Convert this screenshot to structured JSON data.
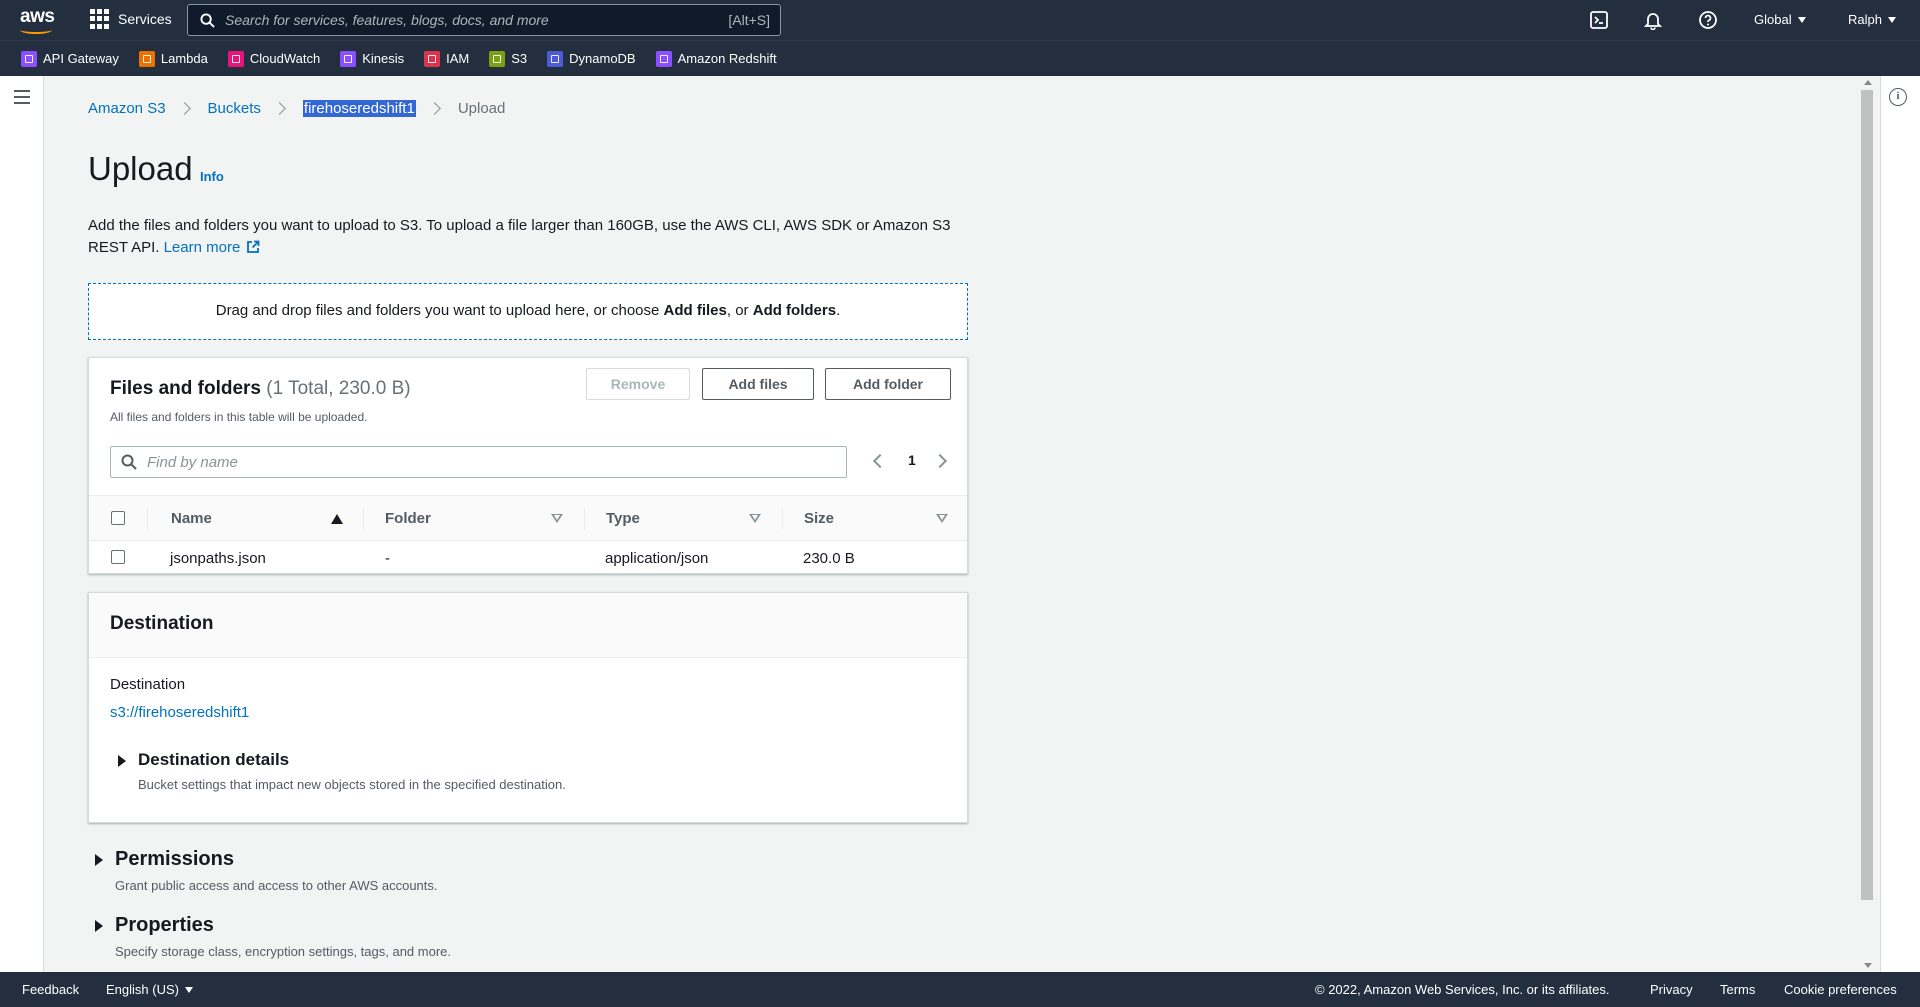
{
  "topnav": {
    "logo_text": "aws",
    "services_label": "Services",
    "search_placeholder": "Search for services, features, blogs, docs, and more",
    "search_shortcut": "[Alt+S]",
    "region_label": "Global",
    "user_label": "Ralph"
  },
  "favorites": [
    {
      "label": "API Gateway",
      "color": "#8c4fff"
    },
    {
      "label": "Lambda",
      "color": "#ed7100"
    },
    {
      "label": "CloudWatch",
      "color": "#e7157b"
    },
    {
      "label": "Kinesis",
      "color": "#8c4fff"
    },
    {
      "label": "IAM",
      "color": "#dd344c"
    },
    {
      "label": "S3",
      "color": "#7aa116"
    },
    {
      "label": "DynamoDB",
      "color": "#4d5bd9"
    },
    {
      "label": "Amazon Redshift",
      "color": "#8c4fff"
    }
  ],
  "breadcrumb": {
    "items": [
      "Amazon S3",
      "Buckets",
      "firehoseredshift1"
    ],
    "current": "Upload"
  },
  "page": {
    "title": "Upload",
    "info_link": "Info",
    "description": "Add the files and folders you want to upload to S3. To upload a file larger than 160GB, use the AWS CLI, AWS SDK or Amazon S3 REST API.",
    "learn_more": "Learn more"
  },
  "dropzone": {
    "text_before": "Drag and drop files and folders you want to upload here, or choose",
    "add_files": "Add files",
    "text_mid": ", or",
    "add_folders": "Add folders",
    "text_end": "."
  },
  "files_panel": {
    "title": "Files and folders",
    "count": "(1 Total, 230.0 B)",
    "subtitle": "All files and folders in this table will be uploaded.",
    "remove_label": "Remove",
    "add_files_label": "Add files",
    "add_folder_label": "Add folder",
    "find_placeholder": "Find by name",
    "page_number": "1",
    "columns": [
      "Name",
      "Folder",
      "Type",
      "Size"
    ],
    "rows": [
      {
        "name": "jsonpaths.json",
        "folder": "-",
        "type": "application/json",
        "size": "230.0 B"
      }
    ]
  },
  "destination_panel": {
    "title": "Destination",
    "label": "Destination",
    "link": "s3://firehoseredshift1",
    "details_title": "Destination details",
    "details_sub": "Bucket settings that impact new objects stored in the specified destination."
  },
  "sections": [
    {
      "title": "Permissions",
      "subtitle": "Grant public access and access to other AWS accounts."
    },
    {
      "title": "Properties",
      "subtitle": "Specify storage class, encryption settings, tags, and more."
    }
  ],
  "footer": {
    "feedback": "Feedback",
    "language": "English (US)",
    "copyright": "© 2022, Amazon Web Services, Inc. or its affiliates.",
    "privacy": "Privacy",
    "terms": "Terms",
    "cookie": "Cookie preferences"
  },
  "colors": {
    "nav_bg": "#232f3e",
    "link": "#0073bb",
    "accent": "#ff9900"
  },
  "icons": [
    "grid-icon",
    "search-icon",
    "cloudshell-icon",
    "bell-icon",
    "help-icon",
    "hamburger-icon",
    "info-icon",
    "external-link-icon",
    "sort-icon"
  ]
}
